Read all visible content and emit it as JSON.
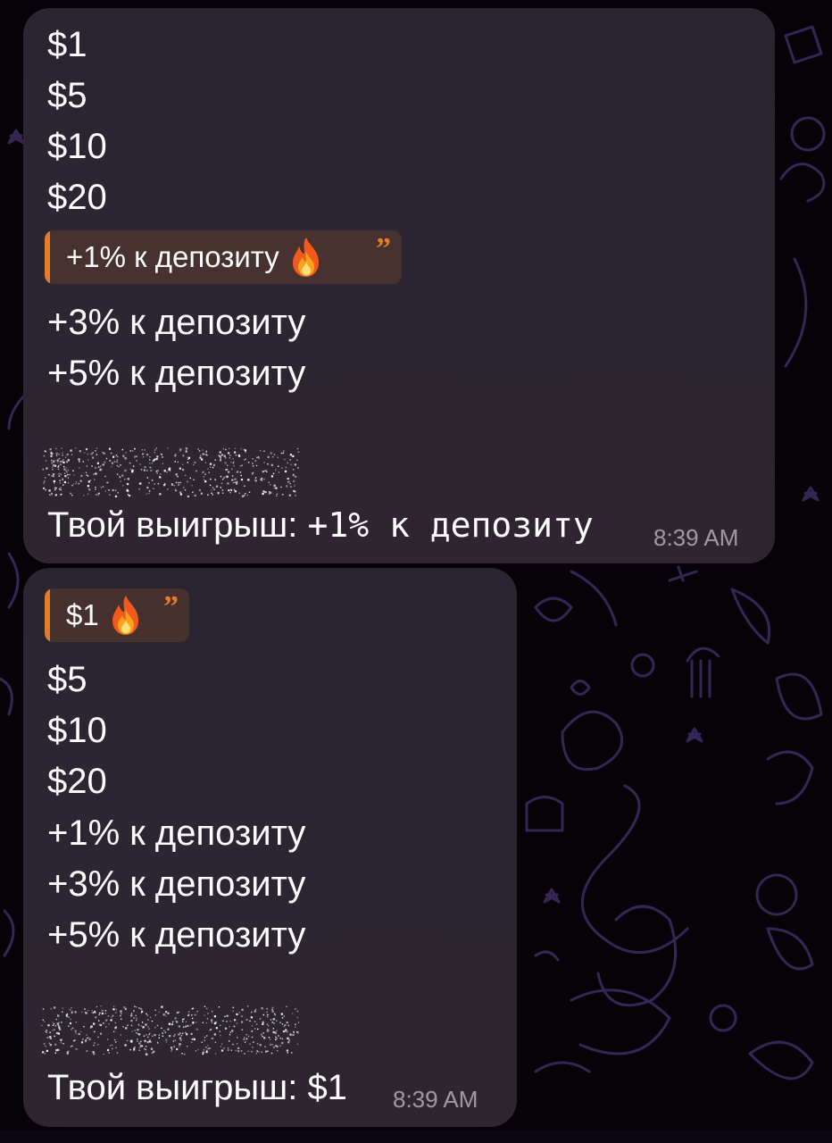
{
  "messages": [
    {
      "lines_top": [
        "$1",
        "$5",
        "$10",
        "$20"
      ],
      "quote": {
        "text": "+1% к депозиту",
        "icon": "fire-icon",
        "mark": "”"
      },
      "lines_bottom": [
        "+3% к депозиту",
        "+5% к депозиту"
      ],
      "result_label": "Твой выигрыш:",
      "result_value": "+1% к депозиту",
      "time": "8:39 AM"
    },
    {
      "quote": {
        "text": "$1",
        "icon": "fire-icon",
        "mark": "”"
      },
      "lines": [
        "$5",
        "$10",
        "$20",
        "+1% к депозиту",
        "+3% к депозиту",
        "+5% к депозиту"
      ],
      "result_label": "Твой выигрыш:",
      "result_value": "$1",
      "time": "8:39 AM"
    }
  ],
  "colors": {
    "bubble": "#2a2530",
    "quote_accent": "#e07c2a",
    "wallpaper_doodle": "#3a2a5e",
    "background": "#050308"
  }
}
